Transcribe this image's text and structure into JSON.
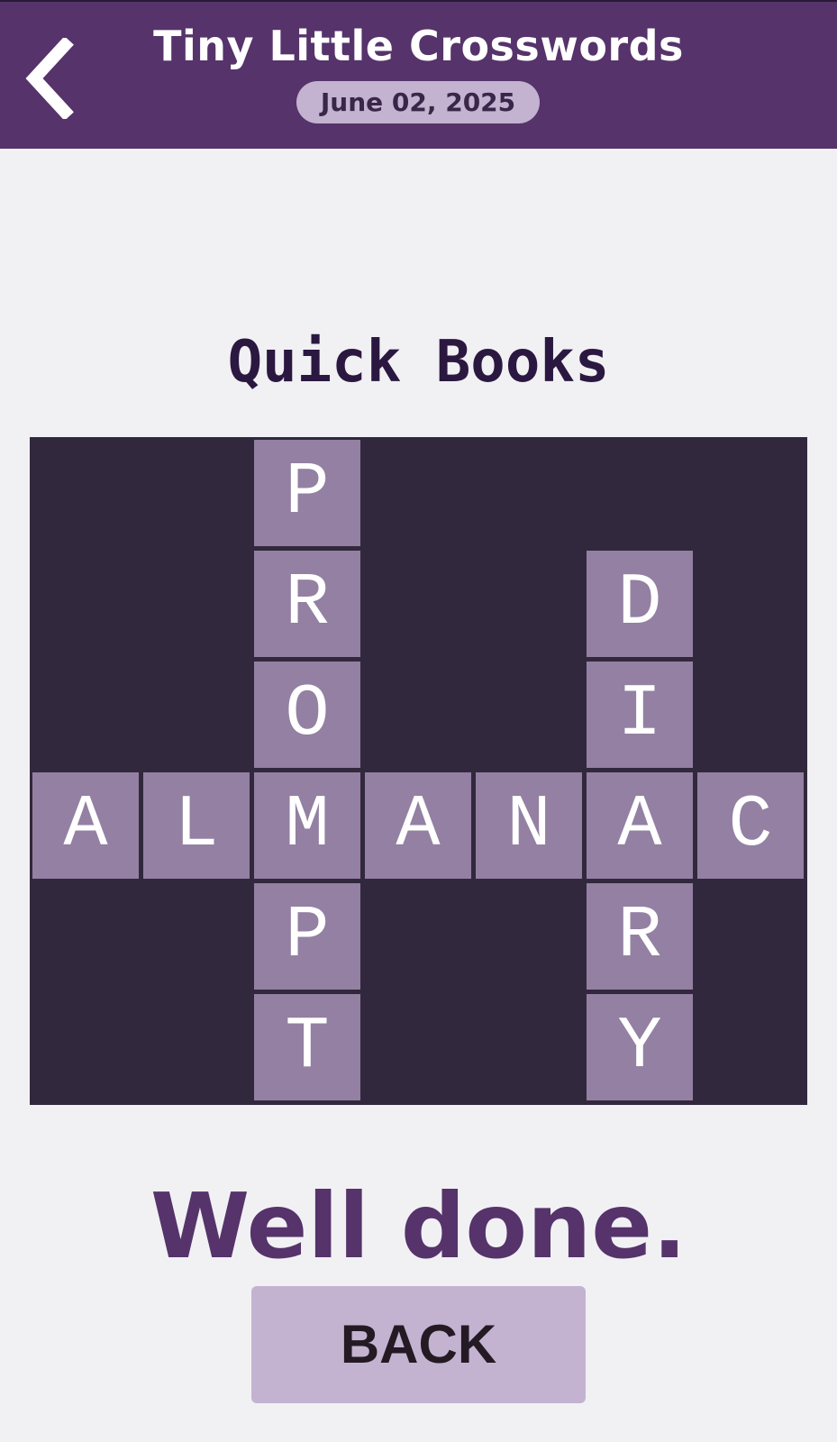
{
  "header": {
    "title": "Tiny Little Crosswords",
    "date": "June 02, 2025",
    "back_icon": "chevron-left-icon"
  },
  "puzzle": {
    "title": "Quick Books",
    "grid_rows": 6,
    "grid_cols": 7,
    "cells": [
      {
        "row": 0,
        "col": 2,
        "letter": "P"
      },
      {
        "row": 1,
        "col": 2,
        "letter": "R"
      },
      {
        "row": 1,
        "col": 5,
        "letter": "D"
      },
      {
        "row": 2,
        "col": 2,
        "letter": "O"
      },
      {
        "row": 2,
        "col": 5,
        "letter": "I"
      },
      {
        "row": 3,
        "col": 0,
        "letter": "A"
      },
      {
        "row": 3,
        "col": 1,
        "letter": "L"
      },
      {
        "row": 3,
        "col": 2,
        "letter": "M"
      },
      {
        "row": 3,
        "col": 3,
        "letter": "A"
      },
      {
        "row": 3,
        "col": 4,
        "letter": "N"
      },
      {
        "row": 3,
        "col": 5,
        "letter": "A"
      },
      {
        "row": 3,
        "col": 6,
        "letter": "C"
      },
      {
        "row": 4,
        "col": 2,
        "letter": "P"
      },
      {
        "row": 4,
        "col": 5,
        "letter": "R"
      },
      {
        "row": 5,
        "col": 2,
        "letter": "T"
      },
      {
        "row": 5,
        "col": 5,
        "letter": "Y"
      }
    ]
  },
  "result": {
    "message": "Well done.",
    "back_label": "BACK"
  },
  "colors": {
    "header_bg": "#56336b",
    "grid_bg": "#32283d",
    "cell_bg": "#9380a2",
    "pill_bg": "#c3b3d1"
  }
}
